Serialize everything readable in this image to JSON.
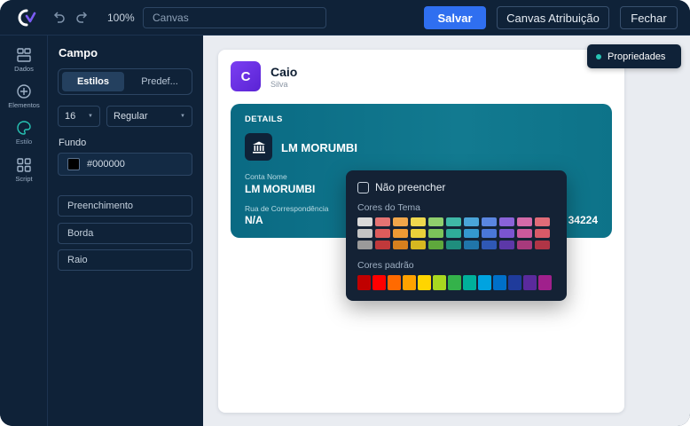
{
  "topbar": {
    "zoom": "100%",
    "canvas_name": "Canvas",
    "save_label": "Salvar",
    "attr_label": "Canvas Atribuição",
    "close_label": "Fechar"
  },
  "rail": [
    {
      "label": "Dados",
      "icon": "layout-icon"
    },
    {
      "label": "Elementos",
      "icon": "plus-circle-icon"
    },
    {
      "label": "Estilo",
      "icon": "palette-icon"
    },
    {
      "label": "Script",
      "icon": "grid-icon"
    }
  ],
  "panel": {
    "title": "Campo",
    "tab_styles": "Estilos",
    "tab_presets": "Predef...",
    "font_size": "16",
    "font_weight": "Regular",
    "background_label": "Fundo",
    "background_value": "#000000",
    "fill_label": "Preenchimento",
    "border_label": "Borda",
    "radius_label": "Raio"
  },
  "card": {
    "avatar_letter": "C",
    "name": "Caio",
    "surname": "Silva",
    "details_title": "DETAILS",
    "bank_name": "LM MORUMBI",
    "account_label": "Conta Nome",
    "account_value": "LM MORUMBI",
    "address_label": "Rua de Correspondência",
    "address_value": "N/A",
    "partial_value": "34224"
  },
  "properties_pill": "Propriedades",
  "color_picker": {
    "no_fill_label": "Não preencher",
    "theme_label": "Cores do Tema",
    "standard_label": "Cores padrão",
    "theme_colors": [
      [
        "#d9d9d9",
        "#e47373",
        "#f0a64a",
        "#eed84e",
        "#8fcf6d",
        "#3fb8a6",
        "#4aa4d8",
        "#5a86e0",
        "#8a63d8",
        "#d46aa8",
        "#e06b78"
      ],
      [
        "#c4c4c4",
        "#dc5c5c",
        "#ee9a34",
        "#ead13a",
        "#7cc45a",
        "#2fac9a",
        "#3498cf",
        "#4a77d8",
        "#7b55cf",
        "#cc5a9c",
        "#d85a68"
      ],
      [
        "#9a9a9a",
        "#c0393b",
        "#d7801e",
        "#d6b820",
        "#5ea83c",
        "#1f8d7d",
        "#2075aa",
        "#2f58b5",
        "#5c38a8",
        "#a83a7c",
        "#b03546"
      ]
    ],
    "standard_colors": [
      "#c00000",
      "#ff0000",
      "#ff6a00",
      "#ffa200",
      "#ffd500",
      "#a8d820",
      "#34b24a",
      "#00b09b",
      "#00a3e0",
      "#0070c9",
      "#1f3b9b",
      "#5a2a9c",
      "#a0208c"
    ]
  }
}
